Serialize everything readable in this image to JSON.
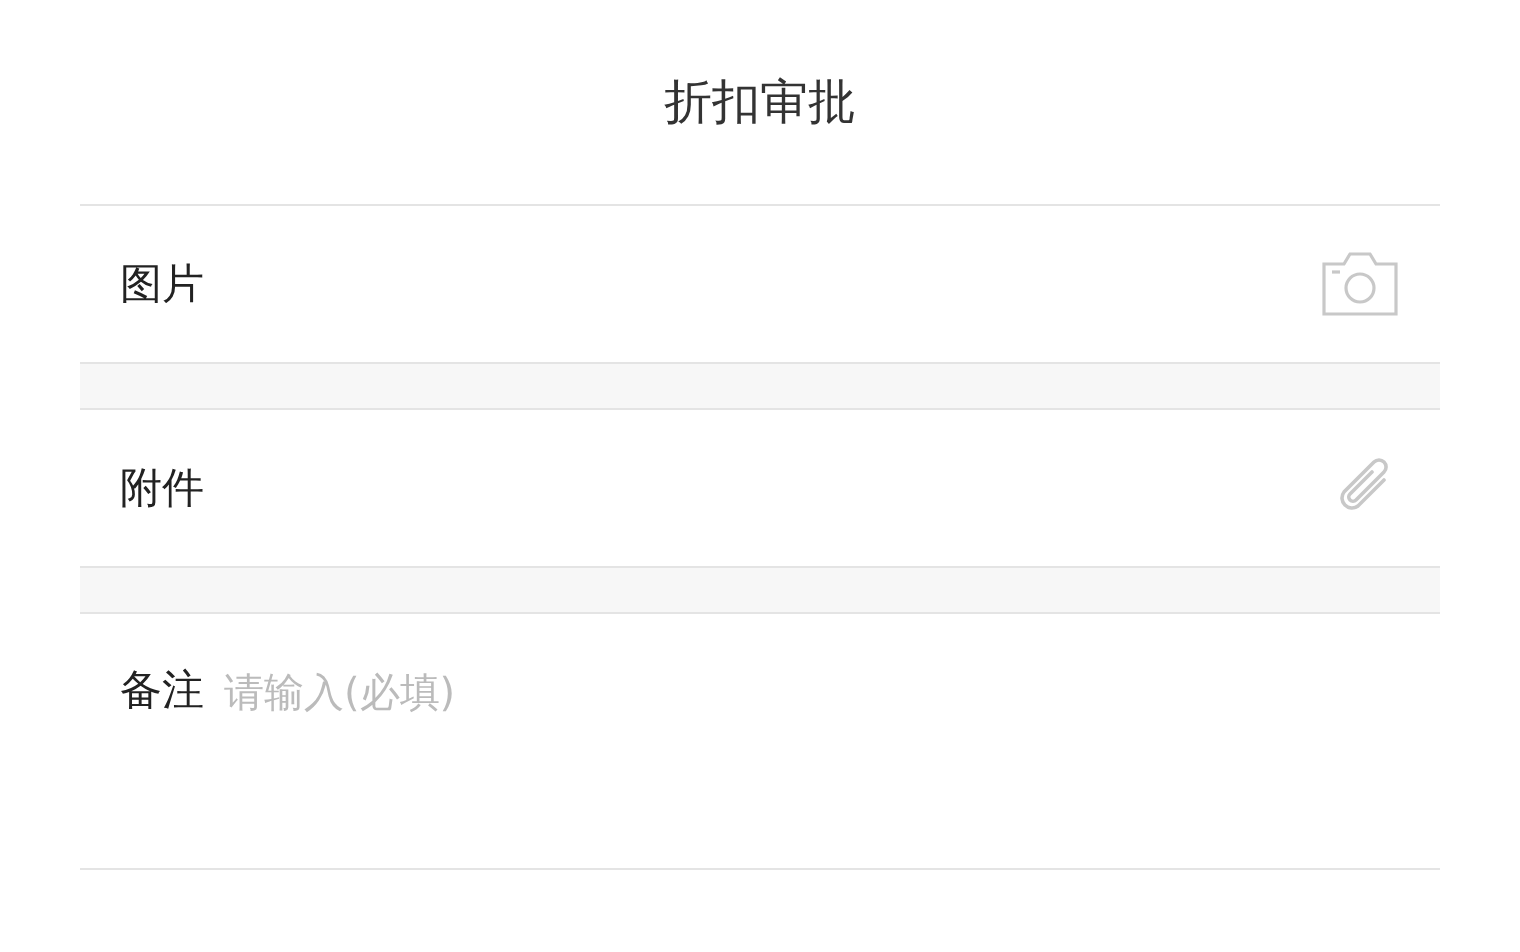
{
  "title": "折扣审批",
  "fields": [
    {
      "kind": "image",
      "label": "图片"
    },
    {
      "kind": "attachment",
      "label": "附件"
    },
    {
      "kind": "note",
      "label": "备注",
      "placeholder": "请输入(必填)"
    }
  ]
}
